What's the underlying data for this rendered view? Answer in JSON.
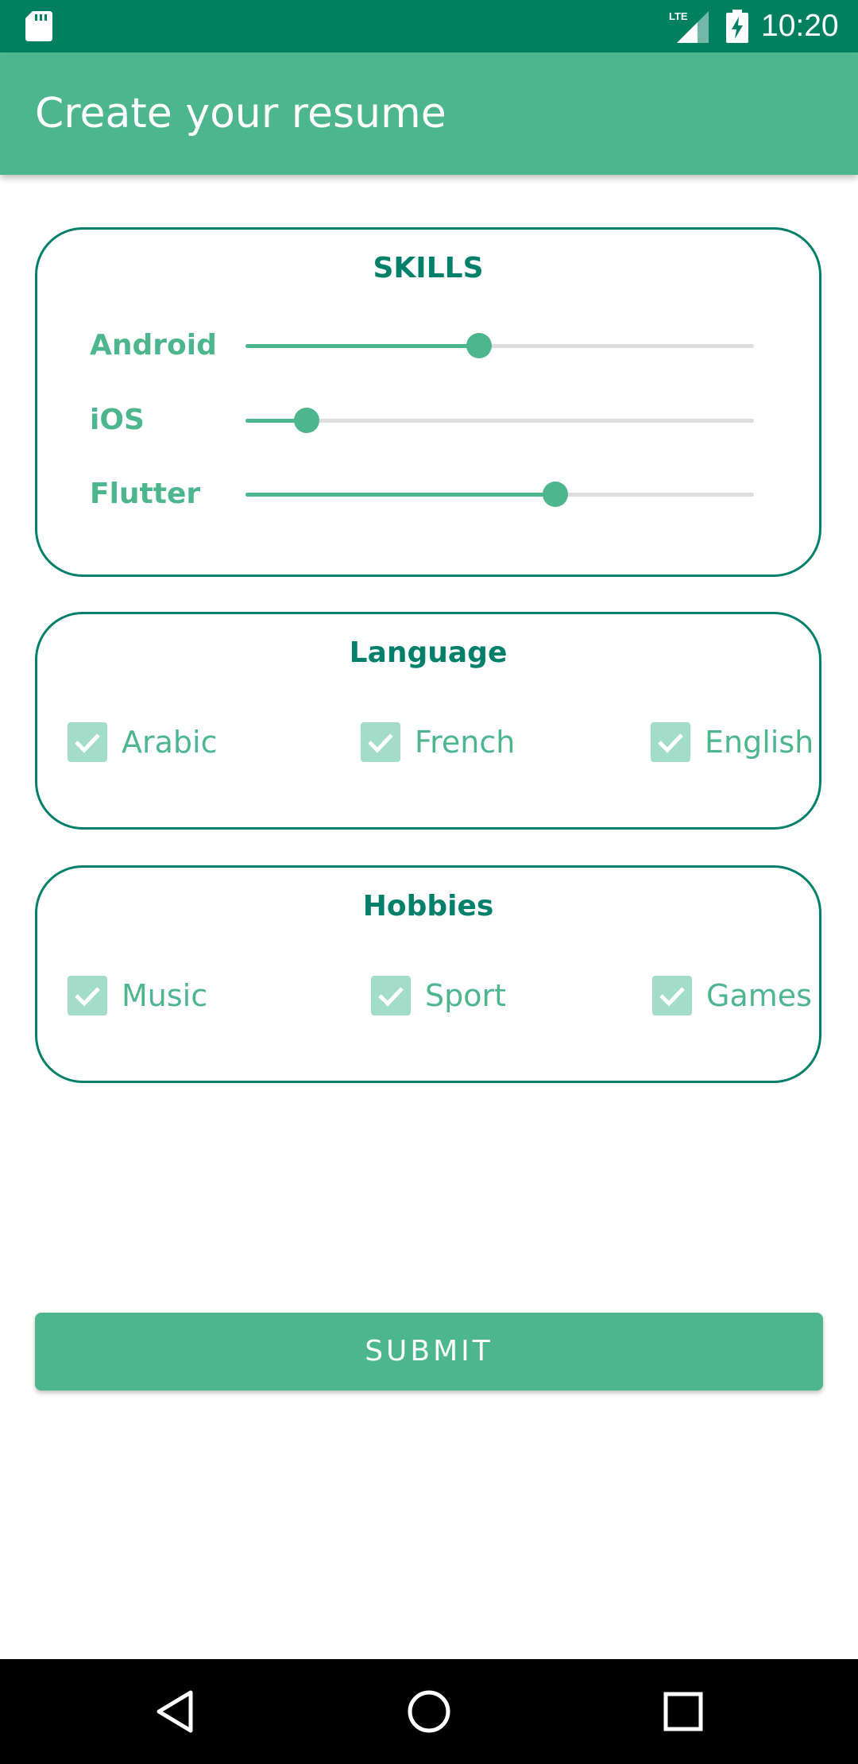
{
  "status_bar": {
    "time": "10:20",
    "network": "LTE",
    "icons": [
      "sd-card-icon",
      "lte-signal-icon",
      "battery-charging-icon"
    ]
  },
  "app_bar": {
    "title": "Create your resume"
  },
  "skills": {
    "title": "SKILLS",
    "items": [
      {
        "label": "Android",
        "value": 0.46
      },
      {
        "label": "iOS",
        "value": 0.12
      },
      {
        "label": "Flutter",
        "value": 0.61
      }
    ]
  },
  "language": {
    "title": "Language",
    "options": [
      {
        "label": "Arabic",
        "checked": true
      },
      {
        "label": "French",
        "checked": true
      },
      {
        "label": "English",
        "checked": true
      }
    ]
  },
  "hobbies": {
    "title": "Hobbies",
    "options": [
      {
        "label": "Music",
        "checked": true
      },
      {
        "label": "Sport",
        "checked": true
      },
      {
        "label": "Games",
        "checked": true
      }
    ]
  },
  "submit_label": "SUBMIT",
  "navigation": {
    "buttons": [
      "back-icon",
      "home-icon",
      "recents-icon"
    ]
  },
  "colors": {
    "status_bar": "#008060",
    "primary": "#4db68e",
    "accent_dark": "#00806a",
    "checkbox_fill": "#a3dcc8",
    "track": "#dddddd"
  }
}
